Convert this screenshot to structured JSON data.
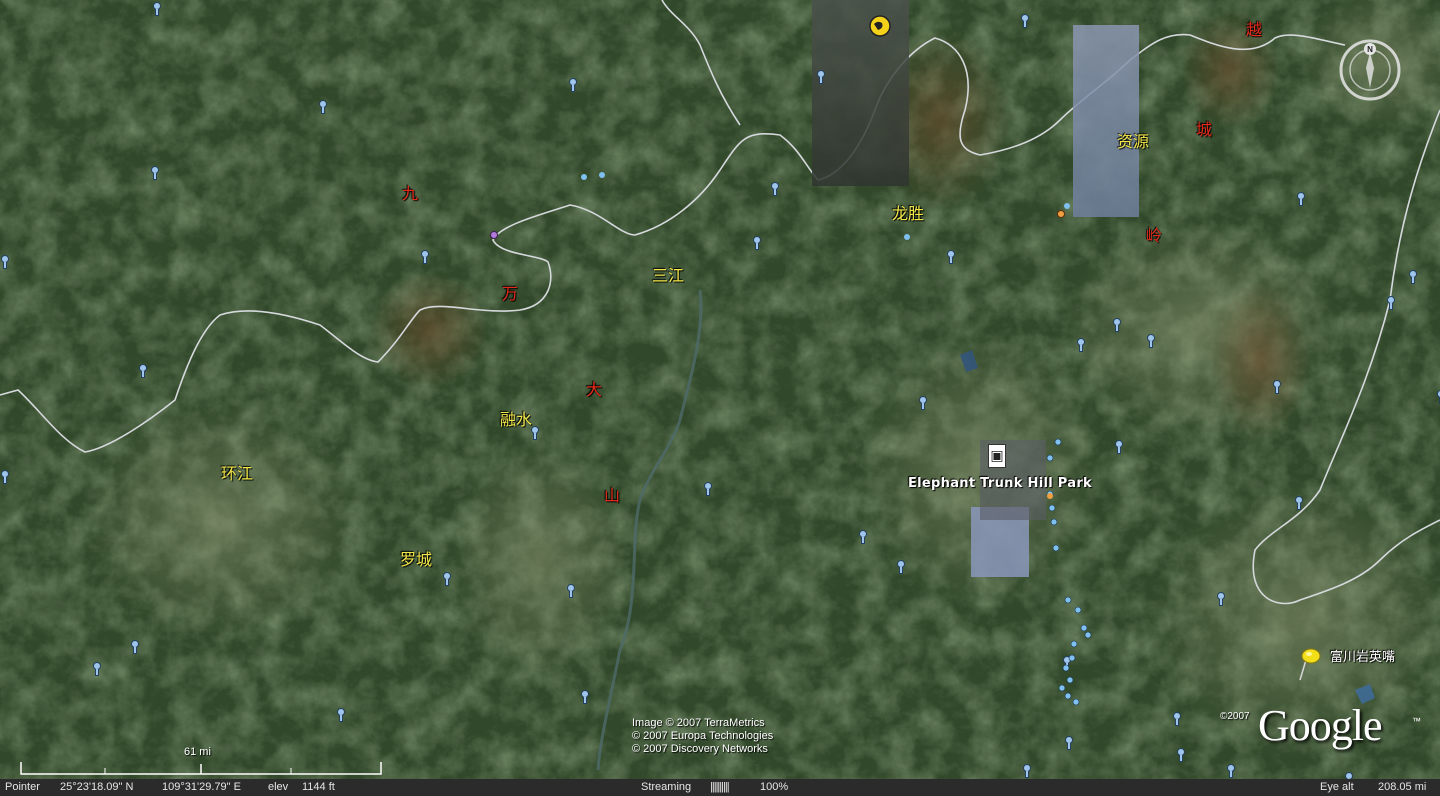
{
  "map": {
    "colors": {
      "terrain_dark": "#24381f",
      "terrain_mid": "#3c5530",
      "terrain_light": "#7a8a60",
      "border_line": "#cfd3d8",
      "label_yellow": "#f2e84a",
      "label_red": "#e22a1a"
    },
    "labels_yellow": [
      {
        "key": "sanjiang",
        "text": "三江"
      },
      {
        "key": "longsheng",
        "text": "龙胜"
      },
      {
        "key": "ziyuan",
        "text": "资源"
      },
      {
        "key": "rongshui",
        "text": "融水"
      },
      {
        "key": "huanjiang",
        "text": "环江"
      },
      {
        "key": "luocheng",
        "text": "罗城"
      }
    ],
    "labels_red": [
      {
        "key": "jiu",
        "text": "九"
      },
      {
        "key": "wan",
        "text": "万"
      },
      {
        "key": "da",
        "text": "大"
      },
      {
        "key": "shan",
        "text": "山"
      },
      {
        "key": "yue",
        "text": "越"
      },
      {
        "key": "cheng",
        "text": "城"
      },
      {
        "key": "ling",
        "text": "岭"
      }
    ],
    "place_elephant": "Elephant Trunk Hill Park",
    "place_fuchuan": "富川岩英嘴",
    "attribution": [
      "Image © 2007 TerraMetrics",
      "© 2007 Europa Technologies",
      "© 2007 Discovery Networks"
    ],
    "scale_label": "61 mi",
    "google_copyright": "©2007",
    "google_logo": "Google",
    "google_tm": "™",
    "compass_north": "N"
  },
  "status_bar": {
    "pointer_label": "Pointer",
    "lat": "25°23'18.09\" N",
    "lon": "109°31'29.79\" E",
    "elev_label": "elev",
    "elev_value": "1144 ft",
    "streaming_label": "Streaming",
    "streaming_bar": "||||||||||",
    "streaming_pct": "100%",
    "eye_alt_label": "Eye alt",
    "eye_alt_value": "208.05 mi"
  },
  "icons": {
    "place_marker": "place-pin-icon",
    "pushpin": "yellow-pushpin-icon",
    "photo_marker": "photo-marker-icon",
    "compass": "compass-icon"
  }
}
